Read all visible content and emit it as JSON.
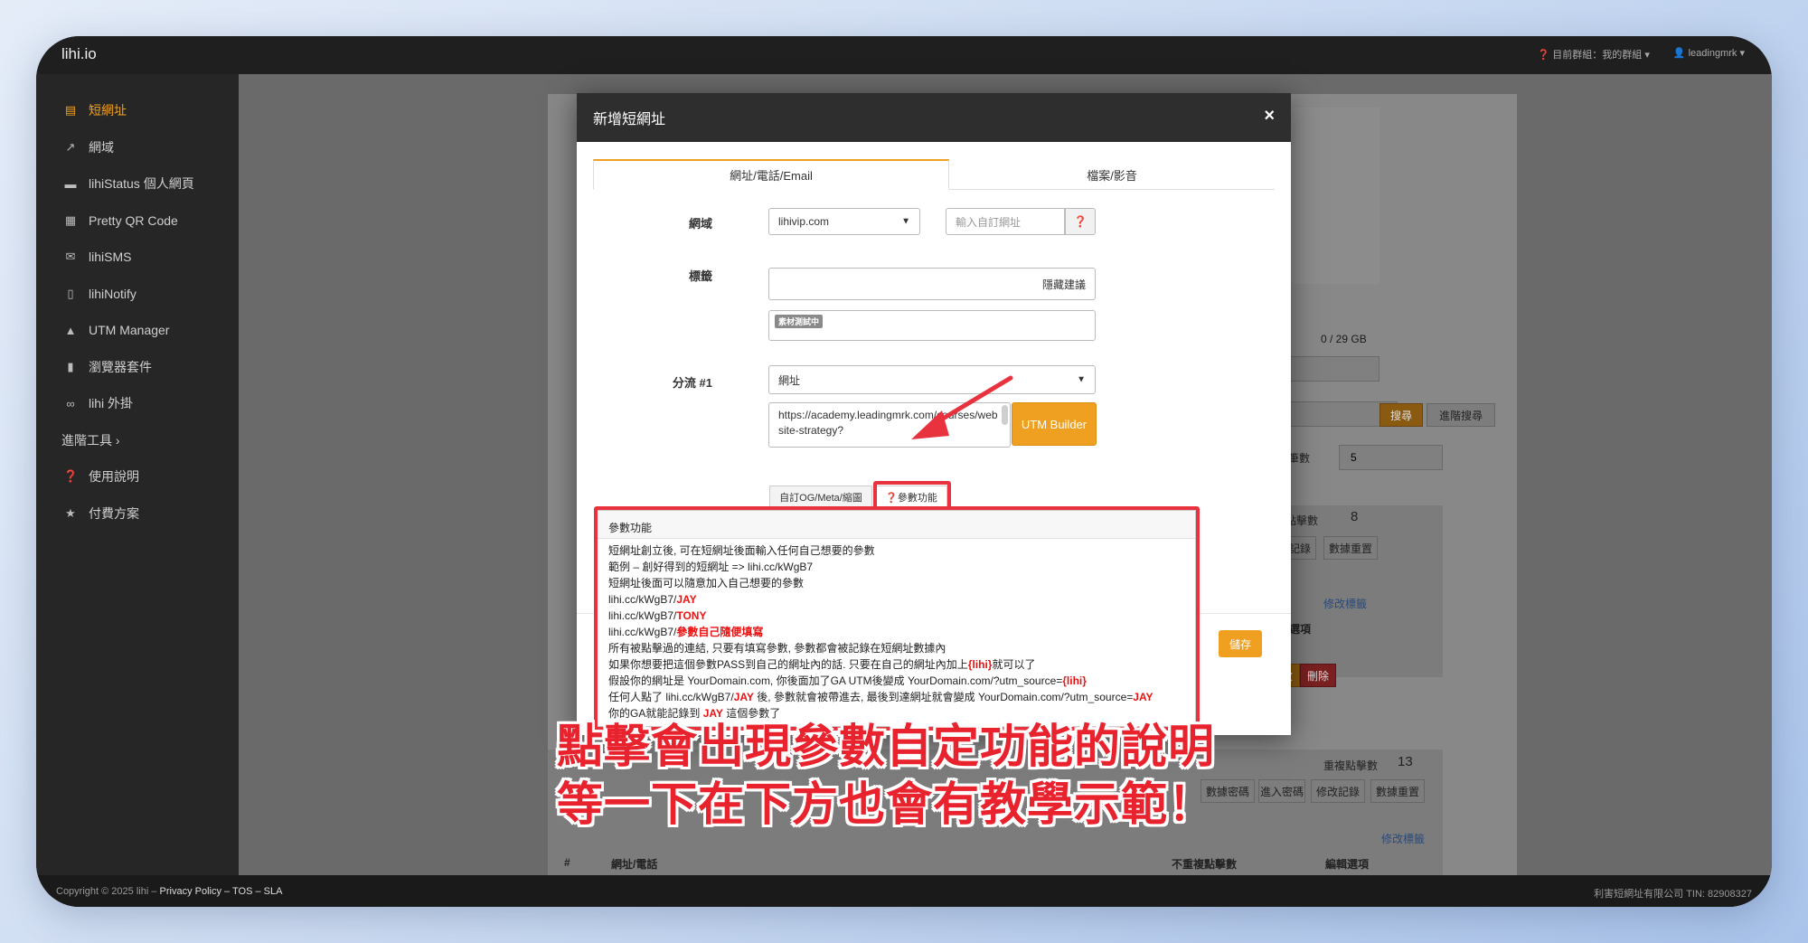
{
  "app": {
    "brand": "lihi.io",
    "group_label": "目前群組：我的群組",
    "user": "leadingmrk"
  },
  "sidebar": {
    "items": [
      {
        "label": "短網址",
        "icon": "list-icon",
        "active": true
      },
      {
        "label": "網域",
        "icon": "external-link-icon"
      },
      {
        "label": "lihiStatus 個人網頁",
        "icon": "bars-icon"
      },
      {
        "label": "Pretty QR Code",
        "icon": "qr-code-icon"
      },
      {
        "label": "lihiSMS",
        "icon": "envelope-icon"
      },
      {
        "label": "lihiNotify",
        "icon": "phone-icon"
      },
      {
        "label": "UTM Manager",
        "icon": "utm-icon"
      },
      {
        "label": "瀏覽器套件",
        "icon": "bookmark-icon"
      },
      {
        "label": "lihi 外掛",
        "icon": "link-icon"
      },
      {
        "label": "進階工具",
        "icon": "",
        "group": true
      },
      {
        "label": "使用說明",
        "icon": "question-icon"
      },
      {
        "label": "付費方案",
        "icon": "star-icon"
      }
    ]
  },
  "background": {
    "storage": "0 / 29 GB",
    "search_btn": "搜尋",
    "adv_search_btn": "進階搜尋",
    "per_page_label": "每頁筆數",
    "per_page_value": "5",
    "dup_clicks_1": "重複點擊數",
    "dup_clicks_1_value": "8",
    "dup_clicks_2": "重複點擊數",
    "dup_clicks_2_value": "13",
    "enter_pw": "進入密碼",
    "edit_log": "修改記錄",
    "reset_data": "數據重置",
    "edit_tags": "修改標籤",
    "edit_options": "編輯選項",
    "edit_btn": "修改",
    "delete_btn": "刪除",
    "col_hash": "#",
    "col_url": "網址/電話",
    "col_unique": "不重複點擊數",
    "data_pw": "數據密碼"
  },
  "modal": {
    "title": "新增短網址",
    "close": "×",
    "tabs": [
      "網址/電話/Email",
      "檔案/影音"
    ],
    "domain_label": "網域",
    "domain_value": "lihivip.com",
    "custom_placeholder": "輸入自訂網址",
    "tags_label": "標籤",
    "hide_suggest": "隱藏建議",
    "tag_chip": "素材測試中",
    "split_label": "分流 #1",
    "split_value": "網址",
    "url_text": "https://academy.leadingmrk.com/courses/website-strategy?",
    "utm_builder": "UTM Builder",
    "og_btn": "自訂OG/Meta/縮圖",
    "param_btn": "❓參數功能",
    "save": "儲存"
  },
  "popover": {
    "title": "參數功能",
    "lines": [
      {
        "t": "短網址創立後, 可在短網址後面輸入任何自己想要的參數"
      },
      {
        "t": "範例 –  創好得到的短網址 => lihi.cc/kWgB7"
      },
      {
        "t": "短網址後面可以隨意加入自己想要的參數"
      },
      {
        "t": " lihi.cc/kWgB7/",
        "r": "JAY"
      },
      {
        "t": "lihi.cc/kWgB7/",
        "r": "TONY"
      },
      {
        "t": "lihi.cc/kWgB7/",
        "r": "參數自己隨便填寫"
      },
      {
        "t": "所有被點擊過的連結, 只要有填寫參數, 參數都會被記錄在短網址數據內"
      },
      {
        "t": "如果你想要把這個參數PASS到自己的網址內的話. 只要在自己的網址內加上",
        "r": "{lihi}",
        "t2": "就可以了"
      },
      {
        "t": "假設你的網址是 YourDomain.com, 你後面加了GA UTM後變成 YourDomain.com/?utm_source=",
        "r": "{lihi}"
      },
      {
        "t": "任何人點了 lihi.cc/kWgB7/",
        "r": "JAY",
        "t2": " 後, 參數就會被帶進去, 最後到達網址就會變成 YourDomain.com/?utm_source=",
        "r2": "JAY"
      },
      {
        "t": "你的GA就能記錄到 ",
        "r": "JAY",
        "t2": " 這個參數了"
      }
    ]
  },
  "caption": {
    "line1": "點擊會出現參數自定功能的說明",
    "line2": "等一下在下方也會有教學示範！"
  },
  "footer": {
    "copyright": "Copyright © 2025 lihi – ",
    "links": "Privacy Policy – TOS – SLA",
    "company": "利害短網址有限公司 TIN: 82908327"
  },
  "colors": {
    "accent": "#f0a020",
    "highlight": "#e8323e",
    "caption": "#e8232e"
  }
}
